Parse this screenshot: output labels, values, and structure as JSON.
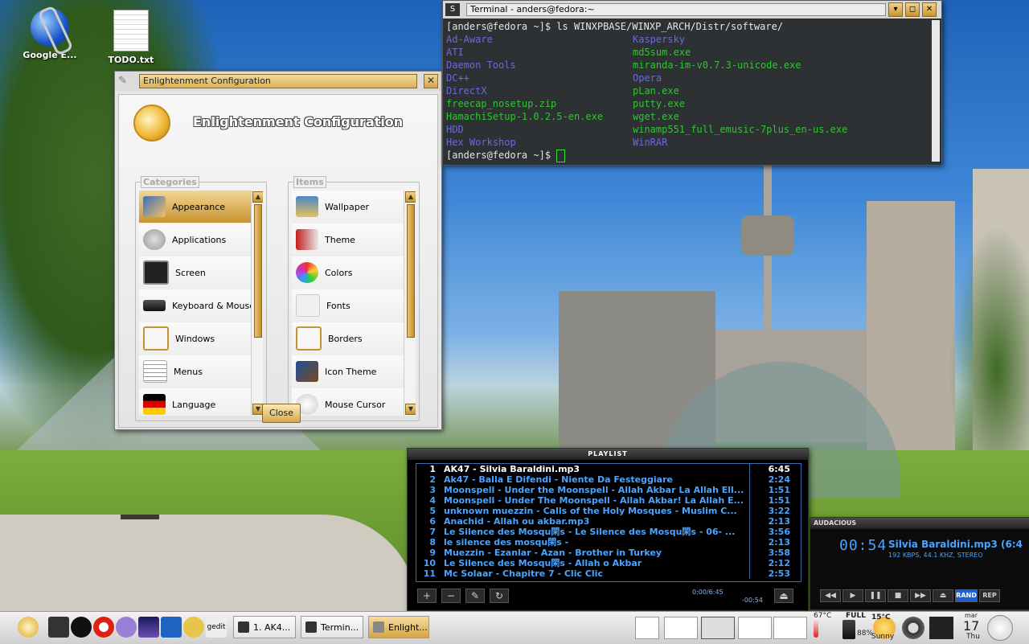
{
  "desktop": {
    "icons": [
      {
        "label": "Google E...",
        "icon": "google-earth-icon"
      },
      {
        "label": "TODO.txt",
        "icon": "text-file-icon"
      }
    ]
  },
  "config_window": {
    "title": "Enlightenment Configuration",
    "heading": "Enlightenment Configuration",
    "categories_label": "Categories",
    "items_label": "Items",
    "categories": [
      {
        "label": "Appearance",
        "icon": "appearance-icon",
        "selected": true
      },
      {
        "label": "Applications",
        "icon": "applications-icon"
      },
      {
        "label": "Screen",
        "icon": "screen-icon"
      },
      {
        "label": "Keyboard & Mouse",
        "icon": "keyboard-mouse-icon"
      },
      {
        "label": "Windows",
        "icon": "windows-icon"
      },
      {
        "label": "Menus",
        "icon": "menus-icon"
      },
      {
        "label": "Language",
        "icon": "language-flag-icon"
      }
    ],
    "items": [
      {
        "label": "Wallpaper",
        "icon": "wallpaper-icon"
      },
      {
        "label": "Theme",
        "icon": "theme-paint-icon"
      },
      {
        "label": "Colors",
        "icon": "palette-icon"
      },
      {
        "label": "Fonts",
        "icon": "fonts-icon"
      },
      {
        "label": "Borders",
        "icon": "borders-icon"
      },
      {
        "label": "Icon Theme",
        "icon": "icon-theme-icon"
      },
      {
        "label": "Mouse Cursor",
        "icon": "mouse-cursor-icon"
      }
    ],
    "close_label": "Close"
  },
  "terminal": {
    "title": "Terminal - anders@fedora:~",
    "prompt": "[anders@fedora ~]$ ",
    "command": "ls WINXPBASE/WINXP_ARCH/Distr/software/",
    "listing": [
      [
        {
          "name": "Ad-Aware",
          "type": "dir"
        },
        {
          "name": "Kaspersky",
          "type": "dir"
        }
      ],
      [
        {
          "name": "ATI",
          "type": "dir"
        },
        {
          "name": "md5sum.exe",
          "type": "exe"
        }
      ],
      [
        {
          "name": "Daemon Tools",
          "type": "dir"
        },
        {
          "name": "miranda-im-v0.7.3-unicode.exe",
          "type": "exe"
        }
      ],
      [
        {
          "name": "DC++",
          "type": "dir"
        },
        {
          "name": "Opera",
          "type": "dir"
        }
      ],
      [
        {
          "name": "DirectX",
          "type": "dir"
        },
        {
          "name": "pLan.exe",
          "type": "exe"
        }
      ],
      [
        {
          "name": "freecap_nosetup.zip",
          "type": "exe"
        },
        {
          "name": "putty.exe",
          "type": "exe"
        }
      ],
      [
        {
          "name": "HamachiSetup-1.0.2.5-en.exe",
          "type": "exe"
        },
        {
          "name": "wget.exe",
          "type": "exe"
        }
      ],
      [
        {
          "name": "HDD",
          "type": "dir"
        },
        {
          "name": "winamp551_full_emusic-7plus_en-us.exe",
          "type": "exe"
        }
      ],
      [
        {
          "name": "Hex Workshop",
          "type": "dir"
        },
        {
          "name": "WinRAR",
          "type": "dir"
        }
      ]
    ],
    "colors": {
      "dir": "#6b6bd8",
      "exe": "#34c234"
    }
  },
  "playlist": {
    "header": "PLAYLIST",
    "tracks": [
      {
        "n": "1",
        "title": "AK47 - Silvia Baraldini.mp3",
        "time": "6:45",
        "current": true
      },
      {
        "n": "2",
        "title": "Ak47 - Balla E Difendi - Niente Da Festeggiare",
        "time": "2:24"
      },
      {
        "n": "3",
        "title": "Moonspell - Under the Moonspell - Allah Akbar La Allah Ell...",
        "time": "1:51"
      },
      {
        "n": "4",
        "title": "Moonspell - Under The Moonspell - Allah Akbar! La Allah E...",
        "time": "1:51"
      },
      {
        "n": "5",
        "title": "unknown muezzin - Calls of the Holy Mosques - Muslim C...",
        "time": "3:22"
      },
      {
        "n": "6",
        "title": "Anachid - Allah ou akbar.mp3",
        "time": "2:13"
      },
      {
        "n": "7",
        "title": "Le Silence des Mosqu閑s  - Le Silence des Mosqu閑s  - 06- ...",
        "time": "3:56"
      },
      {
        "n": "8",
        "title": "le silence des mosqu閑s -",
        "time": "2:13"
      },
      {
        "n": "9",
        "title": "Muezzin - Ezanlar - Azan - Brother in Turkey",
        "time": "3:58"
      },
      {
        "n": "10",
        "title": "Le Silence des Mosqu閑s - Allah o Akbar",
        "time": "2:12"
      },
      {
        "n": "11",
        "title": "Mc Solaar - Chapitre 7 - Clic Clic",
        "time": "2:53"
      }
    ],
    "position": "0:00/6:45",
    "remaining": "-00:54"
  },
  "audacious": {
    "title": "AUDACIOUS",
    "timer": "00:54",
    "song": "Silvia Baraldini.mp3 (6:4",
    "info": "192 KBPS, 44.1 KHZ, STEREO",
    "rand_label": "RAND",
    "rep_label": "REP"
  },
  "taskbar": {
    "tasks": [
      {
        "label": "1. AK4...",
        "icon": "audacious-icon"
      },
      {
        "label": "Termin...",
        "icon": "terminal-icon"
      },
      {
        "label": "Enlight...",
        "icon": "enlightenment-icon",
        "active": true
      }
    ],
    "launchers": [
      "enlightenment-start-icon",
      "terminal-launcher-icon",
      "audacious-launcher-icon",
      "opera-launcher-icon",
      "pidgin-launcher-icon",
      "night-launcher-icon",
      "monitor-launcher-icon",
      "gnome-launcher-icon",
      "gedit-launcher-icon"
    ],
    "gedit_label": "gedit",
    "temperature": "67°C",
    "battery_label": "FULL",
    "battery_percent": "88%",
    "weather_temp": "15°C",
    "weather_desc": "Sunny",
    "date_month": "mar",
    "date_day": "17",
    "date_weekday": "Thu"
  }
}
